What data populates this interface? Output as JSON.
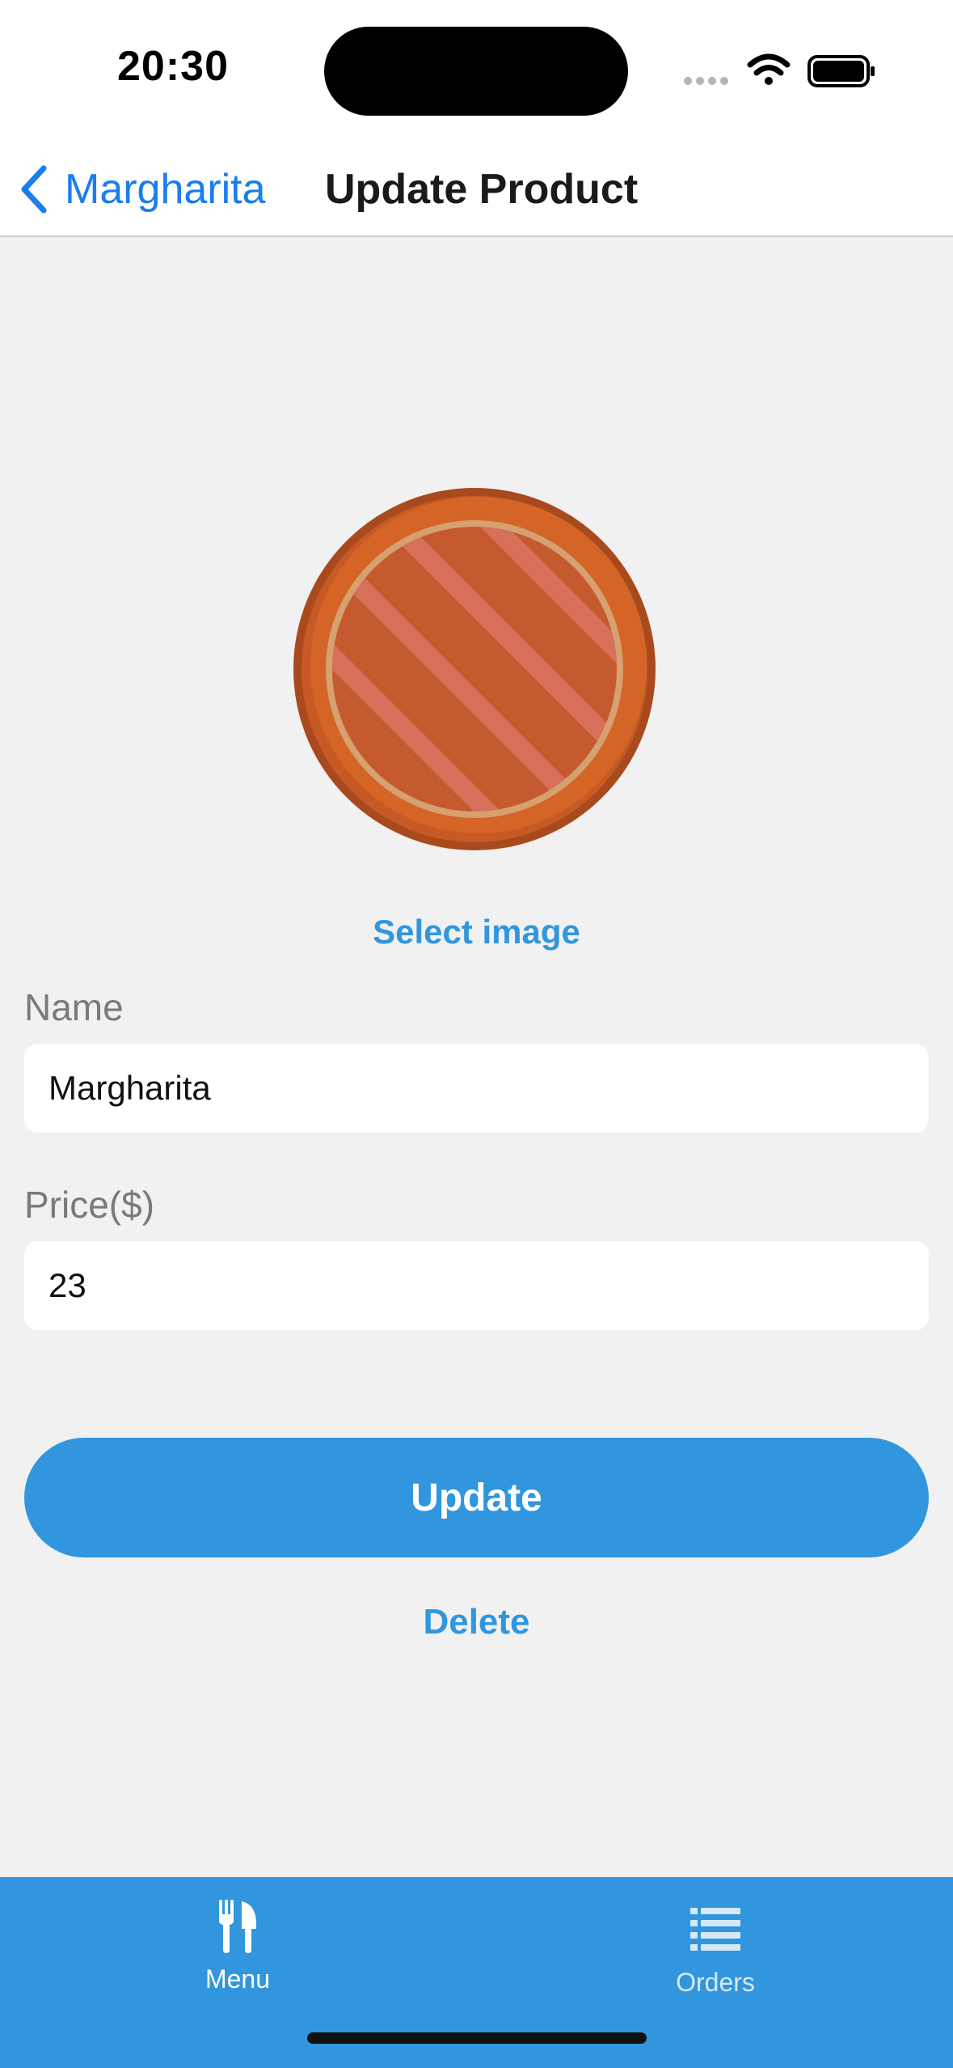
{
  "status_bar": {
    "time": "20:30",
    "icons": [
      "cellular-dots-icon",
      "wifi-icon",
      "battery-icon"
    ]
  },
  "nav": {
    "back_label": "Margharita",
    "title": "Update Product",
    "back_icon": "chevron-left-icon"
  },
  "product_image": {
    "icon": "pizza-icon"
  },
  "select_image_label": "Select image",
  "form": {
    "name": {
      "label": "Name",
      "value": "Margharita"
    },
    "price": {
      "label": "Price($)",
      "value": "23"
    }
  },
  "actions": {
    "update_label": "Update",
    "delete_label": "Delete"
  },
  "tab_bar": {
    "tabs": [
      {
        "label": "Menu",
        "icon": "fork-knife-icon",
        "active": true
      },
      {
        "label": "Orders",
        "icon": "list-icon",
        "active": false
      }
    ]
  },
  "colors": {
    "accent": "#3196dd",
    "nav_link": "#1a7df0",
    "background": "#f1f1f1",
    "tab_inactive": "#d6e9f7"
  }
}
